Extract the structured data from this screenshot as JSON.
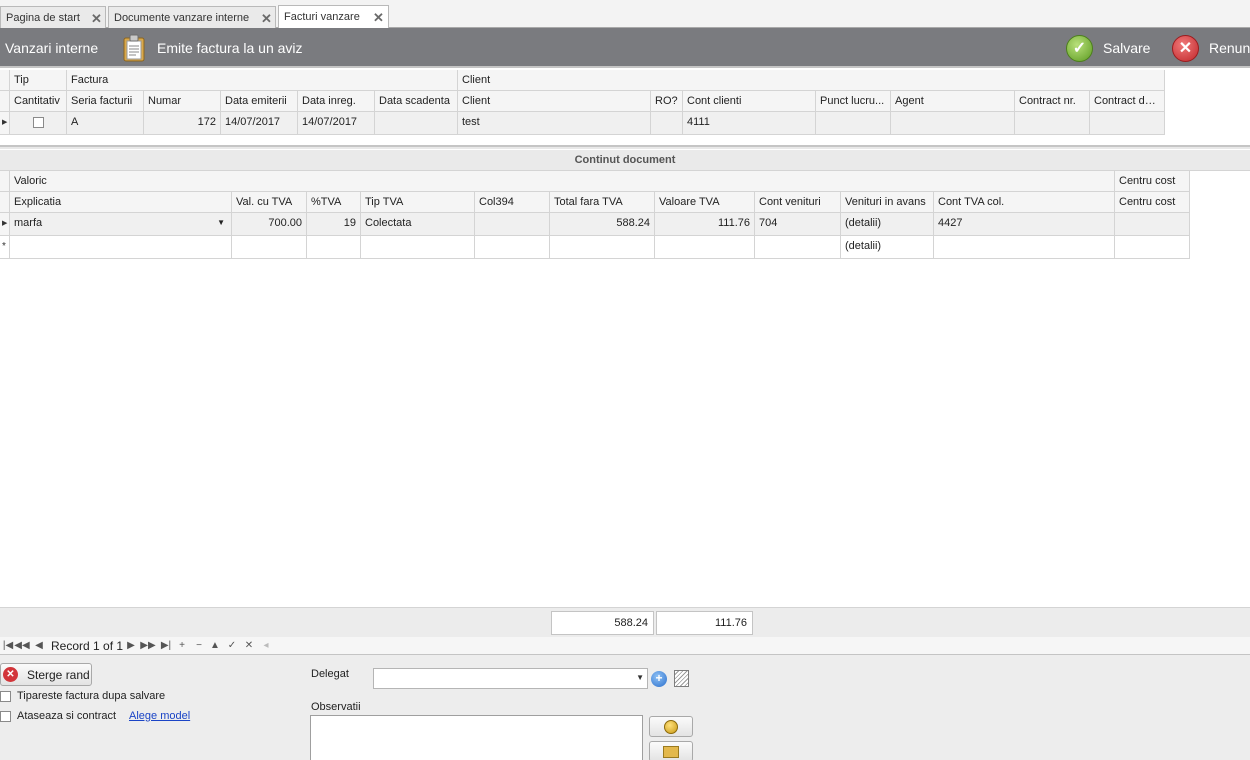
{
  "tabs": [
    {
      "label": "Pagina de start",
      "close": "✕"
    },
    {
      "label": "Documente vanzare interne",
      "close": "✕"
    },
    {
      "label": "Facturi vanzare",
      "close": "✕"
    }
  ],
  "toolbar": {
    "title": "Vanzari interne",
    "emit_label": "Emite factura la un aviz",
    "save_label": "Salvare",
    "cancel_label": "Renunt"
  },
  "header_grid": {
    "bands": [
      "Tip",
      "Factura",
      "Client"
    ],
    "columns": [
      "Cantitativ",
      "Seria facturii",
      "Numar",
      "Data emiterii",
      "Data inreg.",
      "Data scadenta",
      "Client",
      "RO?",
      "Cont clienti",
      "Punct lucru...",
      "Agent",
      "Contract nr.",
      "Contract data"
    ],
    "row": {
      "cantitativ": false,
      "seria": "A",
      "numar": "172",
      "data_emiterii": "14/07/2017",
      "data_inreg": "14/07/2017",
      "data_scadenta": "",
      "client": "test",
      "ro": "",
      "cont_clienti": "4111",
      "punct_lucru": "",
      "agent": "",
      "contract_nr": "",
      "contract_data": ""
    }
  },
  "content": {
    "section_title": "Continut document",
    "bands": [
      "Valoric",
      "Centru cost"
    ],
    "columns": [
      "Explicatia",
      "Val. cu TVA",
      "%TVA",
      "Tip TVA",
      "Col394",
      "Total fara TVA",
      "Valoare TVA",
      "Cont venituri",
      "Venituri in avans",
      "Cont TVA col.",
      "Centru cost"
    ],
    "rows": [
      {
        "explicatia": "marfa",
        "val_cu_tva": "700.00",
        "pct_tva": "19",
        "tip_tva": "Colectata",
        "col394": "",
        "total_fara_tva": "588.24",
        "valoare_tva": "111.76",
        "cont_venituri": "704",
        "venituri_avans": "(detalii)",
        "cont_tva_col": "4427",
        "centru_cost": ""
      },
      {
        "explicatia": "",
        "val_cu_tva": "",
        "pct_tva": "",
        "tip_tva": "",
        "col394": "",
        "total_fara_tva": "",
        "valoare_tva": "",
        "cont_venituri": "",
        "venituri_avans": "(detalii)",
        "cont_tva_col": "",
        "centru_cost": ""
      }
    ],
    "new_row_marker": "*",
    "totals": {
      "total_fara_tva": "588.24",
      "valoare_tva": "111.76"
    }
  },
  "navigator": {
    "record_text": "Record 1 of 1"
  },
  "bottom": {
    "delete_row_label": "Sterge rand",
    "print_after_save_label": "Tipareste factura dupa salvare",
    "print_after_save_checked": false,
    "attach_contract_label": "Ataseaza si contract",
    "attach_contract_checked": false,
    "choose_model_link": "Alege model",
    "delegat_label": "Delegat",
    "delegat_value": "",
    "observatii_label": "Observatii",
    "observatii_value": ""
  },
  "colors": {
    "toolbar_bg": "#7a7b7f",
    "link": "#1a44c6",
    "ok_green": "#5d9b22",
    "cancel_red": "#c0262a"
  }
}
